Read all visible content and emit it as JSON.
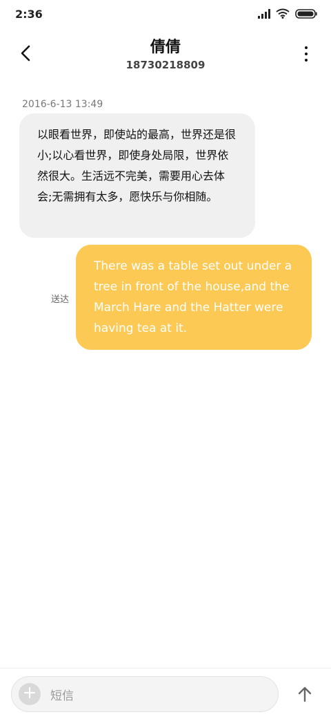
{
  "status_bar": {
    "time": "2:36",
    "icons": [
      "signal-icon",
      "wifi-icon",
      "battery-icon"
    ]
  },
  "header": {
    "contact_name": "倩倩",
    "contact_number": "18730218809",
    "icons": [
      "back-arrow-icon",
      "more-vertical-icon"
    ]
  },
  "conversation": {
    "timestamp": "2016-6-13 13:49",
    "incoming_message": "以眼看世界，即使站的最高，世界还是很小;以心看世界，即使身处局限，世界依然很大。生活远不完美，需要用心去体会;无需拥有太多，愿快乐与你相随。",
    "outgoing_message": "There was a table set out under a tree in front of the house,and the March Hare and the Hatter were having tea at it.",
    "delivery_status": "送达"
  },
  "compose": {
    "placeholder": "短信",
    "icons": [
      "add-icon",
      "send-arrow-icon"
    ]
  },
  "colors": {
    "outgoing_bubble": "#fcc954",
    "incoming_bubble": "#f0f0f0"
  }
}
